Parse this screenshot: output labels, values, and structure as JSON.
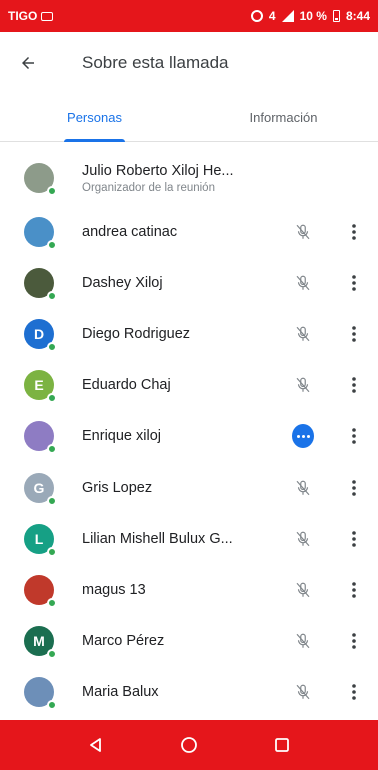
{
  "status_bar": {
    "carrier": "TIGO",
    "signal_text": "4",
    "battery": "10 %",
    "time": "8:44",
    "icons": [
      "cast-icon",
      "alarm-icon",
      "signal-icon",
      "battery-icon"
    ]
  },
  "header": {
    "back_icon": "arrow-back-icon",
    "title": "Sobre esta llamada"
  },
  "tabs": [
    {
      "label": "Personas",
      "active": true
    },
    {
      "label": "Información",
      "active": false
    }
  ],
  "participants": [
    {
      "name": "Julio Roberto Xiloj He...",
      "role": "Organizador de la reunión",
      "avatar_initial": "",
      "avatar_color": "#8d9b8a",
      "mic": "none"
    },
    {
      "name": "andrea catinac",
      "avatar_initial": "",
      "avatar_color": "#4a90c8",
      "mic": "muted"
    },
    {
      "name": "Dashey Xiloj",
      "avatar_initial": "",
      "avatar_color": "#4b5a3c",
      "mic": "muted"
    },
    {
      "name": "Diego Rodriguez",
      "avatar_initial": "D",
      "avatar_color": "#1e6fd1",
      "mic": "muted"
    },
    {
      "name": "Eduardo Chaj",
      "avatar_initial": "E",
      "avatar_color": "#7cb342",
      "mic": "muted"
    },
    {
      "name": "Enrique xiloj",
      "avatar_initial": "",
      "avatar_color": "#8e7cc3",
      "mic": "speaking"
    },
    {
      "name": "Gris Lopez",
      "avatar_initial": "G",
      "avatar_color": "#9aa9b8",
      "mic": "muted"
    },
    {
      "name": "Lilian Mishell Bulux G...",
      "avatar_initial": "L",
      "avatar_color": "#16a085",
      "mic": "muted"
    },
    {
      "name": "magus 13",
      "avatar_initial": "",
      "avatar_color": "#c0392b",
      "mic": "muted"
    },
    {
      "name": "Marco Pérez",
      "avatar_initial": "M",
      "avatar_color": "#1b6e50",
      "mic": "muted"
    },
    {
      "name": "Maria Balux",
      "avatar_initial": "",
      "avatar_color": "#6d8fb8",
      "mic": "muted"
    }
  ],
  "nav_bar": {
    "buttons": [
      "back-triangle-icon",
      "home-circle-icon",
      "recents-square-icon"
    ]
  },
  "colors": {
    "status_bar": "#e5161b",
    "accent": "#1a73e8",
    "presence": "#34a853"
  }
}
